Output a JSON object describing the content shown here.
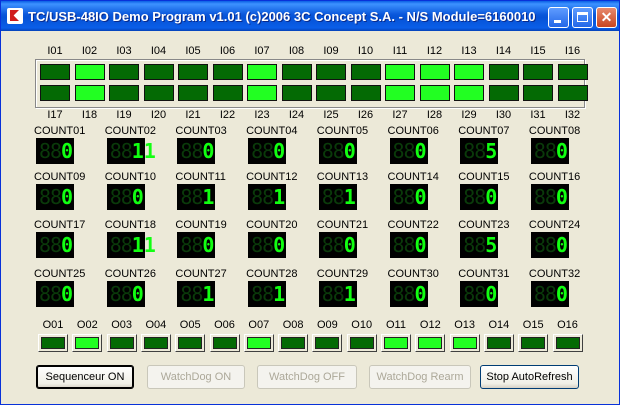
{
  "window": {
    "title": "TC/USB-48IO Demo Program v1.01 (c)2006 3C Concept S.A. - N/S Module=6160010"
  },
  "inputs": {
    "top_labels": [
      "I01",
      "I02",
      "I03",
      "I04",
      "I05",
      "I06",
      "I07",
      "I08",
      "I09",
      "I10",
      "I11",
      "I12",
      "I13",
      "I14",
      "I15",
      "I16"
    ],
    "bottom_labels": [
      "I17",
      "I18",
      "I19",
      "I20",
      "I21",
      "I22",
      "I23",
      "I24",
      "I25",
      "I26",
      "I27",
      "I28",
      "I29",
      "I30",
      "I31",
      "I32"
    ],
    "top_states": [
      0,
      1,
      0,
      0,
      0,
      0,
      1,
      0,
      0,
      0,
      1,
      1,
      1,
      0,
      0,
      0
    ],
    "bottom_states": [
      0,
      1,
      0,
      0,
      0,
      0,
      1,
      0,
      0,
      0,
      1,
      1,
      1,
      0,
      0,
      0
    ]
  },
  "counters": {
    "labels": [
      "COUNT01",
      "COUNT02",
      "COUNT03",
      "COUNT04",
      "COUNT05",
      "COUNT06",
      "COUNT07",
      "COUNT08",
      "COUNT09",
      "COUNT10",
      "COUNT11",
      "COUNT12",
      "COUNT13",
      "COUNT14",
      "COUNT15",
      "COUNT16",
      "COUNT17",
      "COUNT18",
      "COUNT19",
      "COUNT20",
      "COUNT21",
      "COUNT22",
      "COUNT23",
      "COUNT24",
      "COUNT25",
      "COUNT26",
      "COUNT27",
      "COUNT28",
      "COUNT29",
      "COUNT30",
      "COUNT31",
      "COUNT32"
    ],
    "values": [
      "0",
      "11",
      "0",
      "0",
      "0",
      "0",
      "5",
      "0",
      "0",
      "0",
      "1",
      "1",
      "1",
      "0",
      "0",
      "0",
      "0",
      "11",
      "0",
      "0",
      "0",
      "0",
      "5",
      "0",
      "0",
      "0",
      "1",
      "1",
      "1",
      "0",
      "0",
      "0"
    ]
  },
  "outputs": {
    "labels": [
      "O01",
      "O02",
      "O03",
      "O04",
      "O05",
      "O06",
      "O07",
      "O08",
      "O09",
      "O10",
      "O11",
      "O12",
      "O13",
      "O14",
      "O15",
      "O16"
    ],
    "states": [
      0,
      1,
      0,
      0,
      0,
      0,
      1,
      0,
      0,
      0,
      1,
      1,
      1,
      0,
      0,
      0
    ]
  },
  "buttons": {
    "sequenceur": "Sequenceur ON",
    "watchdog_on": "WatchDog ON",
    "watchdog_off": "WatchDog OFF",
    "watchdog_rearm": "WatchDog Rearm",
    "stop_autorefresh": "Stop AutoRefresh"
  }
}
